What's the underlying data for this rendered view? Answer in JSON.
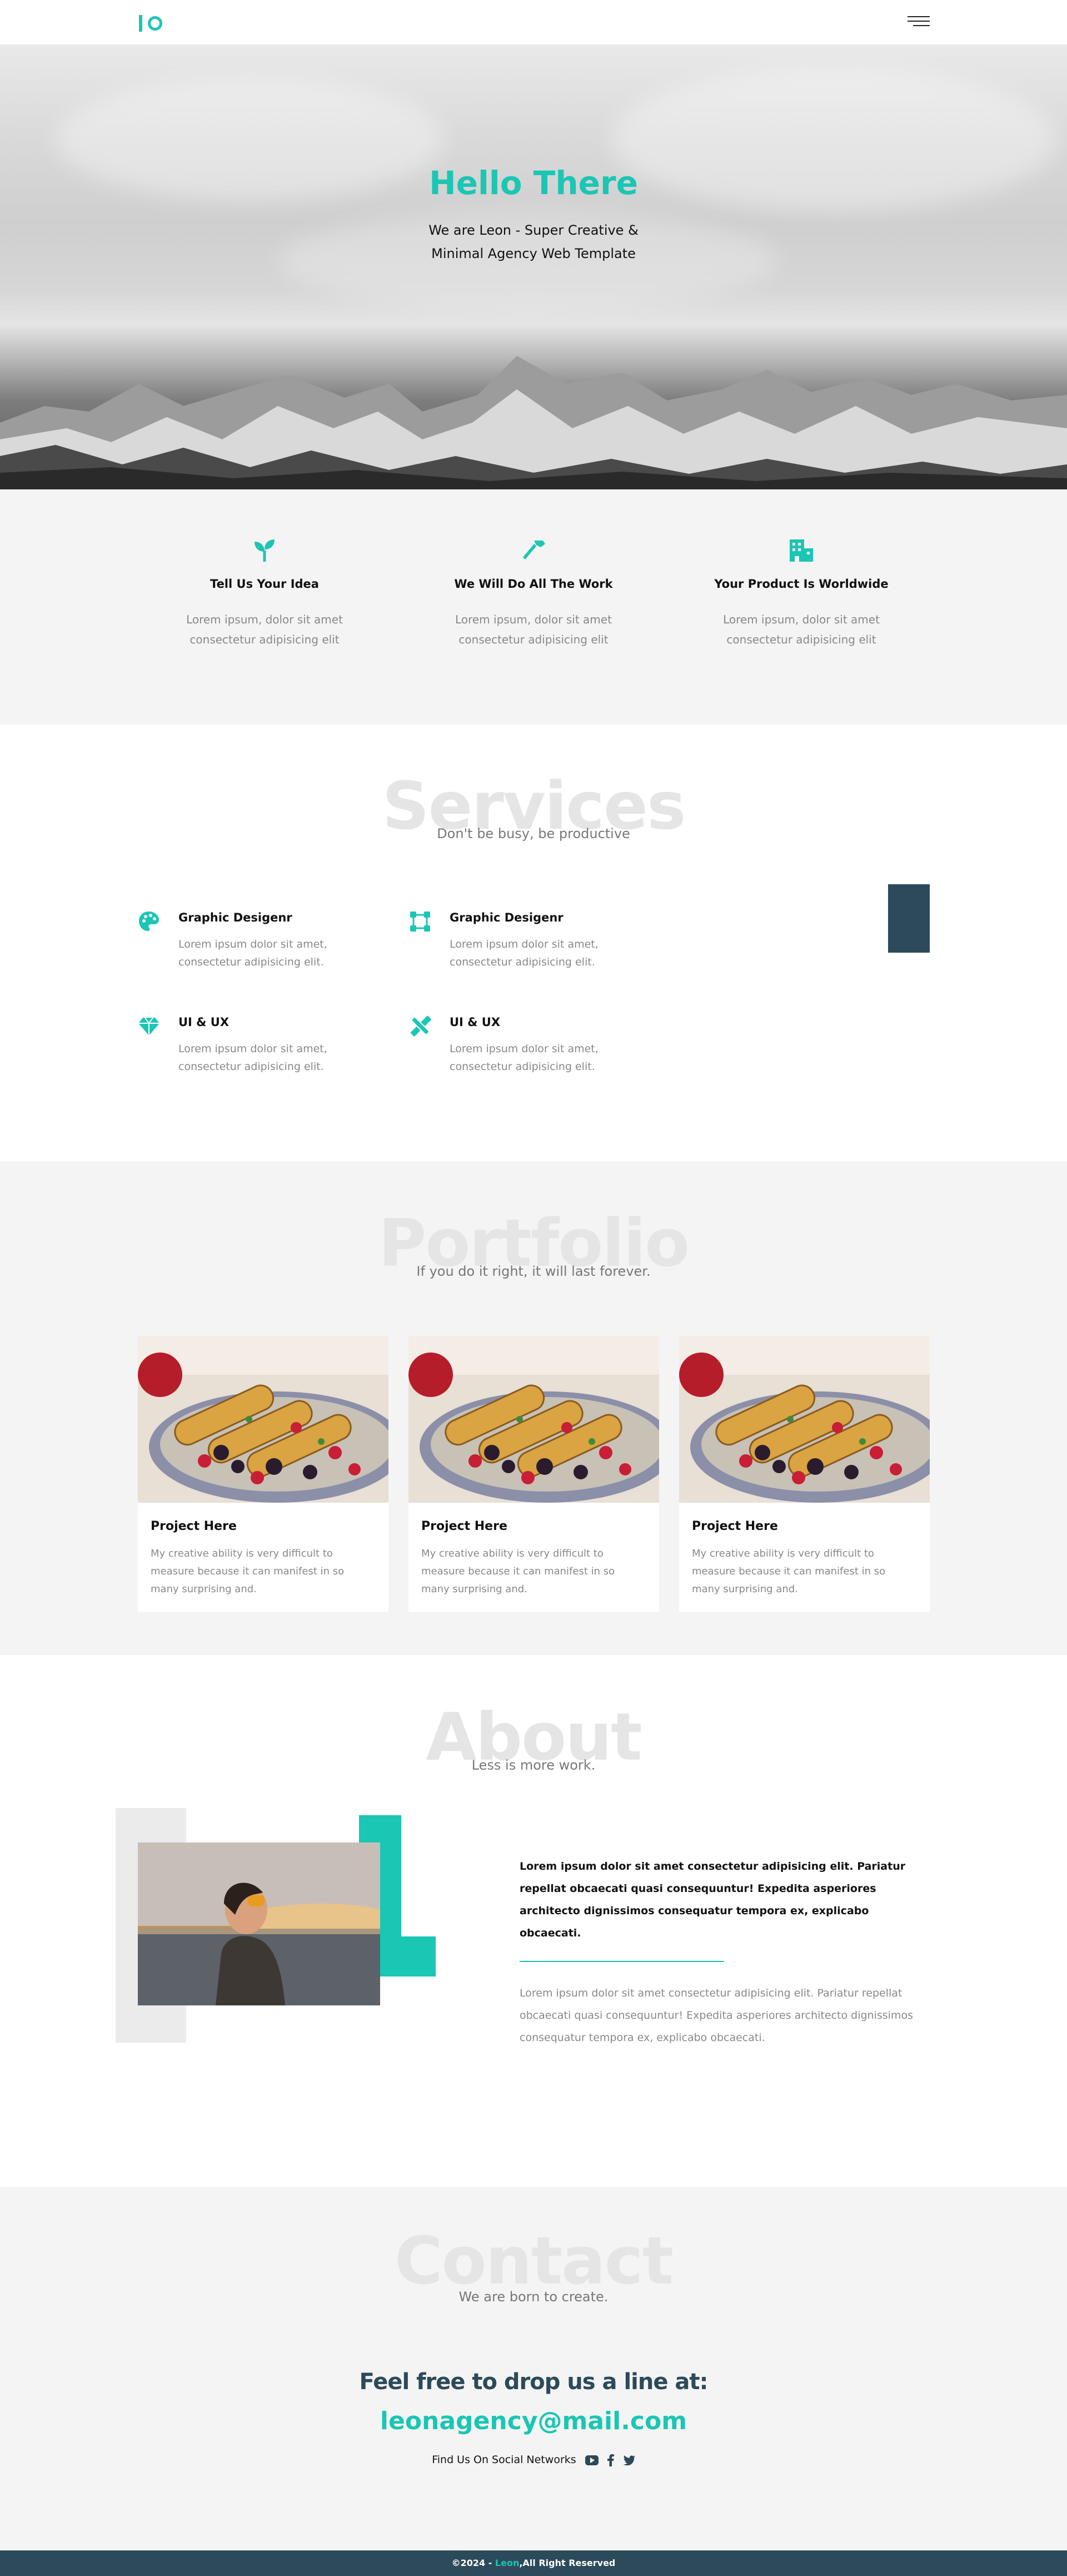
{
  "colors": {
    "accent": "#1ac6b4",
    "dark": "#2c4a5a",
    "muted": "#888888",
    "section_bg": "#f4f4f4"
  },
  "header": {
    "logo_icon": "lo-logo-icon",
    "menu_icon": "hamburger-menu-icon"
  },
  "hero": {
    "title": "Hello There",
    "subtitle_line1": "We are Leon - Super Creative &",
    "subtitle_line2": "Minimal Agency Web Template"
  },
  "features": [
    {
      "icon": "seedling-icon",
      "title": "Tell Us Your Idea",
      "text_line1": "Lorem ipsum, dolor sit amet",
      "text_line2": "consectetur adipisicing elit"
    },
    {
      "icon": "hammer-icon",
      "title": "We Will Do All The Work",
      "text_line1": "Lorem ipsum, dolor sit amet",
      "text_line2": "consectetur adipisicing elit"
    },
    {
      "icon": "building-icon",
      "title": "Your Product Is Worldwide",
      "text_line1": "Lorem ipsum, dolor sit amet",
      "text_line2": "consectetur adipisicing elit"
    }
  ],
  "services": {
    "bg_title": "Services",
    "subtitle": "Don't be busy, be productive",
    "items": [
      {
        "icon": "palette-icon",
        "title": "Graphic Desigenr",
        "text_line1": "Lorem ipsum dolor sit amet,",
        "text_line2": "consectetur adipisicing elit."
      },
      {
        "icon": "bezier-square-icon",
        "title": "Graphic Desigenr",
        "text_line1": "Lorem ipsum dolor sit amet,",
        "text_line2": "consectetur adipisicing elit."
      },
      {
        "icon": "gem-icon",
        "title": "UI & UX",
        "text_line1": "Lorem ipsum dolor sit amet,",
        "text_line2": "consectetur adipisicing elit."
      },
      {
        "icon": "pencil-ruler-icon",
        "title": "UI & UX",
        "text_line1": "Lorem ipsum dolor sit amet,",
        "text_line2": "consectetur adipisicing elit."
      }
    ]
  },
  "portfolio": {
    "bg_title": "Portfolio",
    "subtitle": "If you do it right, it will last forever.",
    "cards": [
      {
        "title": "Project Here",
        "line1": "My creative ability is very difficult to",
        "line2": "measure because it can manifest in so",
        "line3": "many surprising and."
      },
      {
        "title": "Project Here",
        "line1": "My creative ability is very difficult to",
        "line2": "measure because it can manifest in so",
        "line3": "many surprising and."
      },
      {
        "title": "Project Here",
        "line1": "My creative ability is very difficult to",
        "line2": "measure because it can manifest in so",
        "line3": "many surprising and."
      }
    ]
  },
  "about": {
    "bg_title": "About",
    "subtitle": "Less is more work.",
    "bold_text": "Lorem ipsum dolor sit amet consectetur adipisicing elit. Pariatur repellat obcaecati quasi consequuntur! Expedita asperiores architecto dignissimos consequatur tempora ex, explicabo obcaecati.",
    "text": "Lorem ipsum dolor sit amet consectetur adipisicing elit. Pariatur repellat obcaecati quasi consequuntur! Expedita asperiores architecto dignissimos consequatur tempora ex, explicabo obcaecati."
  },
  "contact": {
    "bg_title": "Contact",
    "subtitle": "We are born to create.",
    "heading": "Feel free to drop us a line at:",
    "email": "leonagency@mail.com",
    "social_label": "Find Us On Social Networks",
    "social_icons": [
      "youtube-icon",
      "facebook-icon",
      "twitter-icon"
    ]
  },
  "footer": {
    "prefix": "©2024 - ",
    "brand": "Leon",
    "suffix": ",All Right Reserved"
  }
}
